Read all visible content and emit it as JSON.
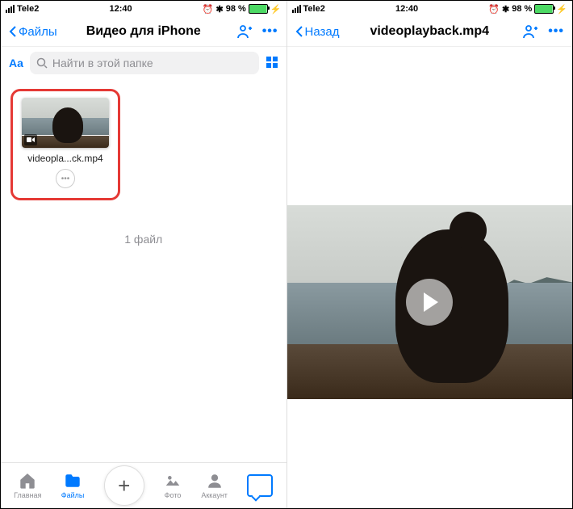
{
  "status": {
    "carrier": "Tele2",
    "time": "12:40",
    "battery_pct": "98 %",
    "alarm_glyph": "⏰",
    "bt_glyph": "✱",
    "charge_glyph": "⚡"
  },
  "left": {
    "back_label": "Файлы",
    "title": "Видео для iPhone",
    "search_placeholder": "Найти в этой папке",
    "aa_label": "Aa",
    "file_name": "videopla...ck.mp4",
    "file_count": "1 файл",
    "tabs": {
      "home": "Главная",
      "files": "Файлы",
      "photo": "Фото",
      "account": "Аккаунт"
    }
  },
  "right": {
    "back_label": "Назад",
    "title": "videoplayback.mp4"
  }
}
